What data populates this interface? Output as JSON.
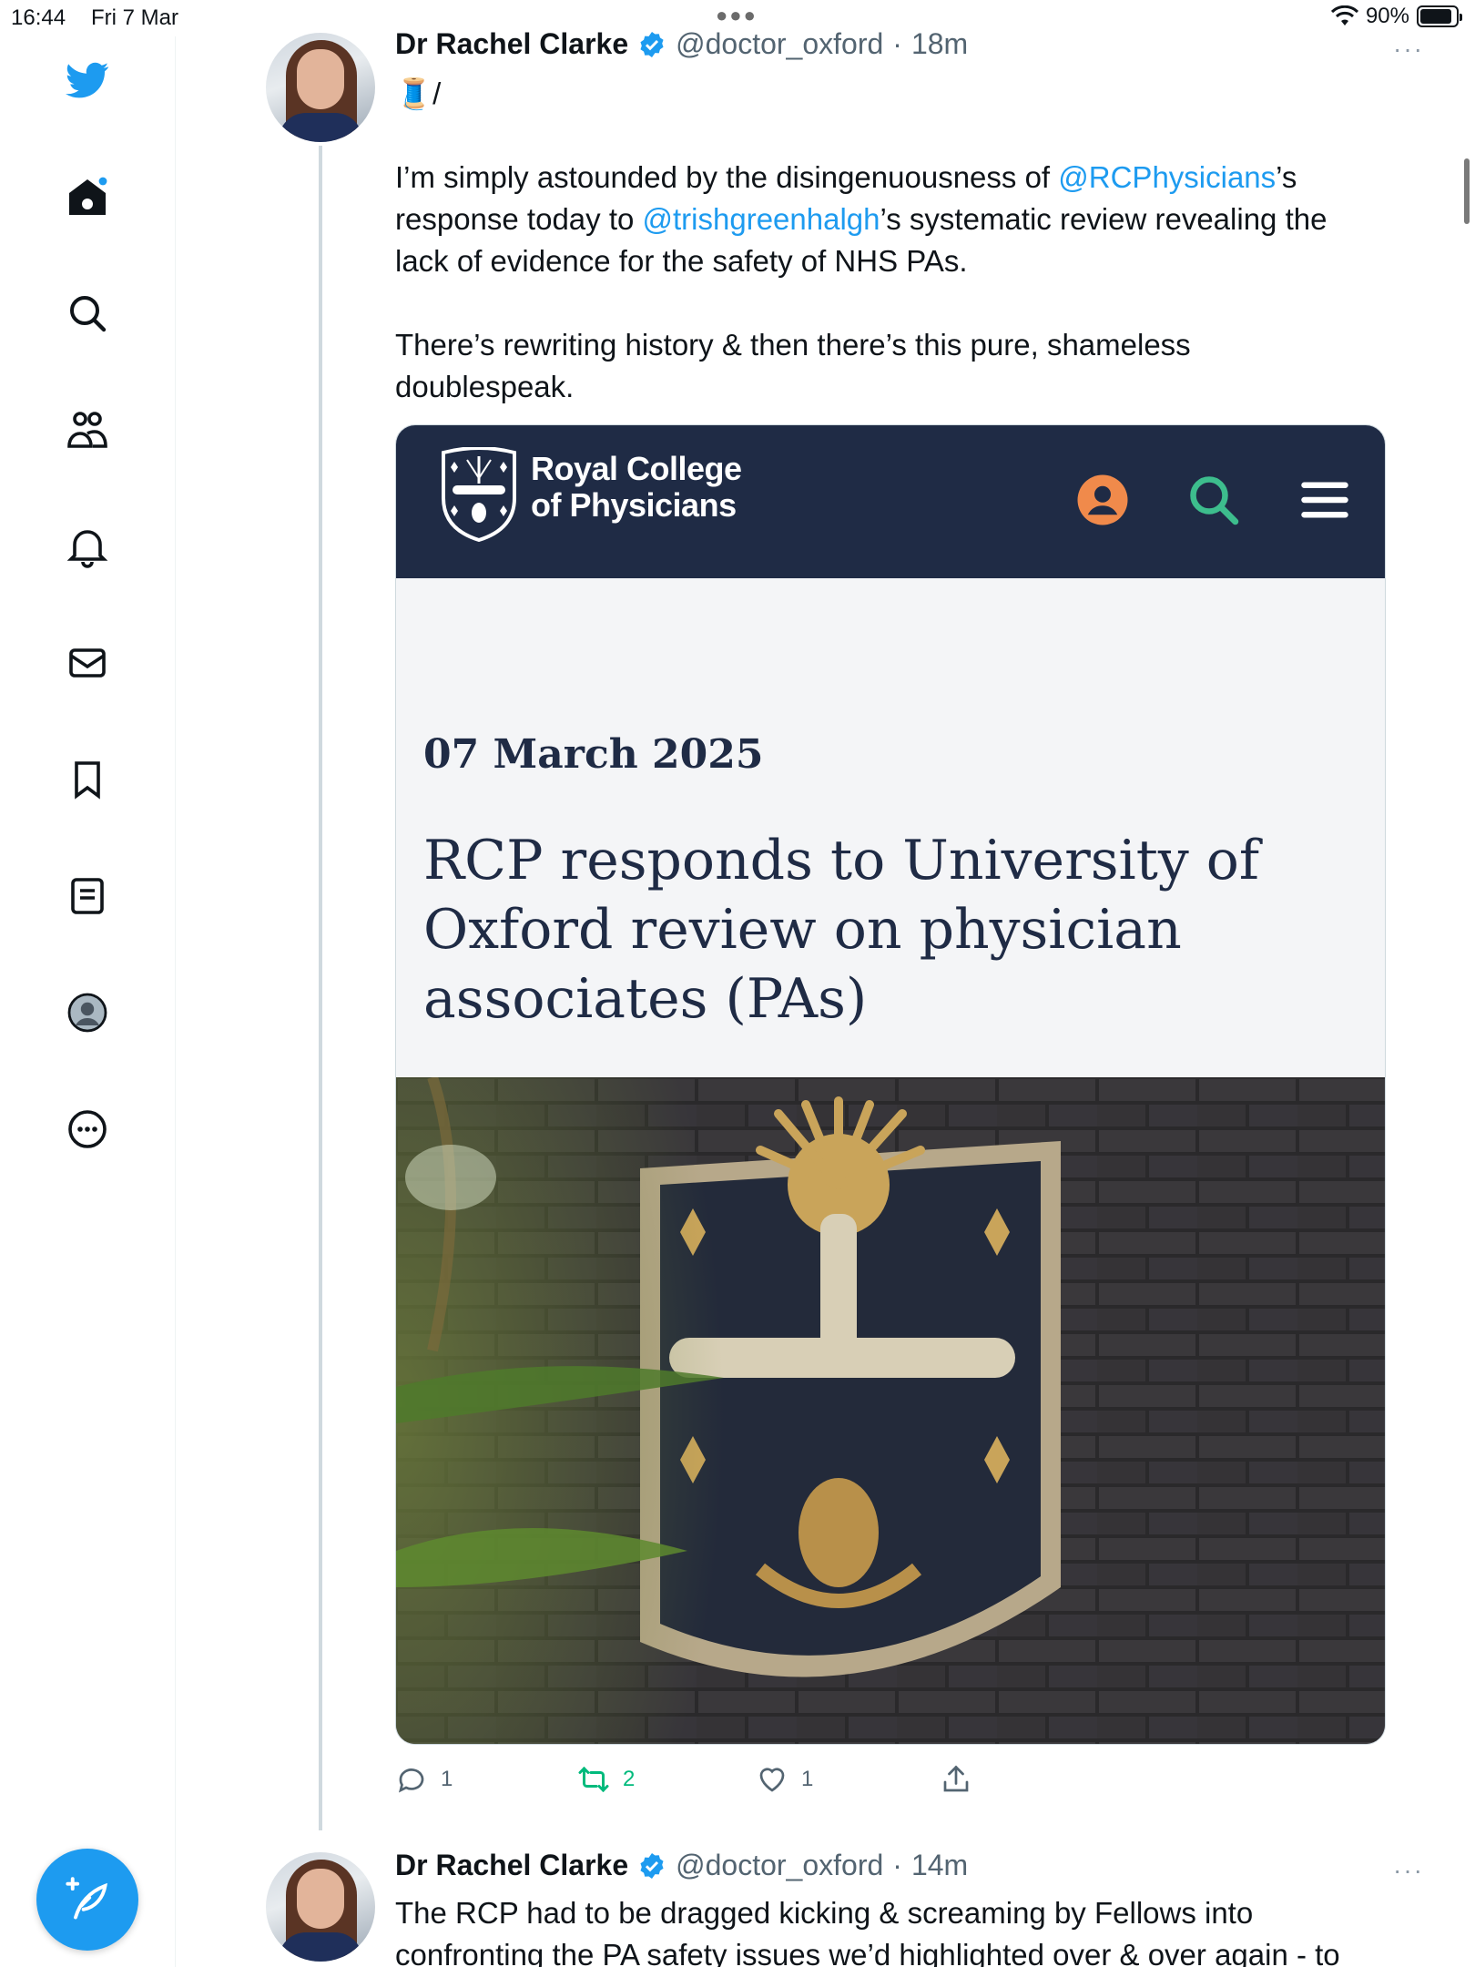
{
  "status_bar": {
    "time": "16:44",
    "date": "Fri 7 Mar",
    "battery": "90%",
    "battery_level": 0.9
  },
  "sidebar": {
    "items": [
      {
        "icon": "twitter-bird-icon"
      },
      {
        "icon": "home-icon",
        "has_notification_dot": true
      },
      {
        "icon": "search-icon"
      },
      {
        "icon": "communities-icon"
      },
      {
        "icon": "notifications-bell-icon"
      },
      {
        "icon": "messages-envelope-icon"
      },
      {
        "icon": "bookmark-icon"
      },
      {
        "icon": "lists-icon"
      },
      {
        "icon": "profile-avatar-icon"
      },
      {
        "icon": "more-options-icon"
      }
    ],
    "compose_icon": "compose-feather-icon"
  },
  "colors": {
    "accent": "#1d9bf0",
    "retweet": "#00ba7c",
    "rcp_navy": "#1f2b45",
    "rcp_orange": "#f08a4b",
    "rcp_green": "#3dbd8d"
  },
  "tweets": [
    {
      "name": "Dr Rachel Clarke",
      "handle": "@doctor_oxford",
      "separator": "·",
      "time": "18m",
      "more": "···",
      "thread_marker": "🧵/",
      "text_parts": [
        "I’m simply astounded by the disingenuousness of ",
        "@RCPhysicians",
        "’s response today to ",
        "@trishgreenhalgh",
        "’s systematic review revealing the lack of evidence for the safety of NHS PAs."
      ],
      "text_para2": "There’s rewriting history & then there’s this pure, shameless doublespeak.",
      "card": {
        "org_name_line1": "Royal College",
        "org_name_line2": "of Physicians",
        "date": "07 March 2025",
        "title": "RCP responds to University of Oxford review on physician associates (PAs)"
      },
      "actions": {
        "replies": "1",
        "retweets": "2",
        "likes": "1"
      }
    },
    {
      "name": "Dr Rachel Clarke",
      "handle": "@doctor_oxford",
      "separator": "·",
      "time": "14m",
      "more": "···",
      "text_line1": "The RCP had to be dragged kicking & screaming by Fellows into",
      "text_line2": "confronting the PA safety issues we’d highlighted over & over again - to"
    }
  ]
}
